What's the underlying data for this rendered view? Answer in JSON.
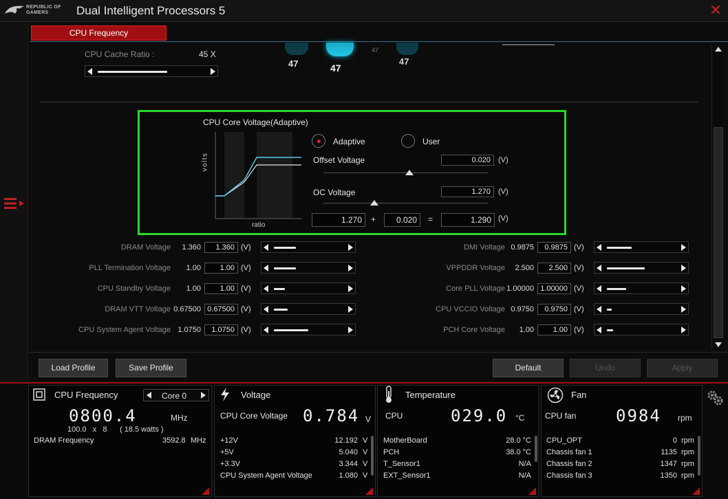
{
  "app": {
    "logo_text_line1": "REPUBLIC OF",
    "logo_text_line2": "GAMERS",
    "title": "Dual Intelligent Processors 5"
  },
  "tab": {
    "label": "CPU Frequency"
  },
  "cache_ratio": {
    "label": "CPU Cache Ratio :",
    "value": "45",
    "unit": "X",
    "slider_level": 0.65
  },
  "indicator_values": [
    "47",
    "47",
    "47",
    "47"
  ],
  "core_voltage": {
    "title": "CPU Core Voltage(Adaptive)",
    "y_axis": "volts",
    "x_axis": "ratio",
    "mode_adaptive": "Adaptive",
    "mode_user": "User",
    "selected_mode": "Adaptive",
    "offset_label": "Offset Voltage",
    "offset_value": "0.020",
    "oc_label": "OC Voltage",
    "oc_value": "1.270",
    "unit": "(V)",
    "sum_a": "1.270",
    "plus": "+",
    "sum_b": "0.020",
    "equals": "=",
    "sum_result": "1.290"
  },
  "left_voltages": [
    {
      "label": "DRAM Voltage",
      "current": "1.360",
      "input": "1.360",
      "unit": "(V)",
      "level": 0.32
    },
    {
      "label": "PLL Termination Voltage",
      "current": "1.00",
      "input": "1.00",
      "unit": "(V)",
      "level": 0.32
    },
    {
      "label": "CPU Standby Voltage",
      "current": "1.00",
      "input": "1.00",
      "unit": "(V)",
      "level": 0.16
    },
    {
      "label": "DRAM VTT Voltage",
      "current": "0.67500",
      "input": "0.67500",
      "unit": "(V)",
      "level": 0.2
    },
    {
      "label": "CPU System Agent Voltage",
      "current": "1.0750",
      "input": "1.0750",
      "unit": "(V)",
      "level": 0.5
    }
  ],
  "right_voltages": [
    {
      "label": "DMI Voltage",
      "current": "0.9875",
      "input": "0.9875",
      "unit": "(V)",
      "level": 0.36
    },
    {
      "label": "VPPDDR Voltage",
      "current": "2.500",
      "input": "2.500",
      "unit": "(V)",
      "level": 0.55
    },
    {
      "label": "Core PLL Voltage",
      "current": "1.00000",
      "input": "1.00000",
      "unit": "(V)",
      "level": 0.28
    },
    {
      "label": "CPU VCCIO Voltage",
      "current": "0.9750",
      "input": "0.9750",
      "unit": "(V)",
      "level": 0.07
    },
    {
      "label": "PCH Core Voltage",
      "current": "1.00",
      "input": "1.00",
      "unit": "(V)",
      "level": 0.09
    }
  ],
  "buttons": {
    "load_profile": "Load Profile",
    "save_profile": "Save Profile",
    "default": "Default",
    "undo": "Undo",
    "apply": "Apply"
  },
  "monitor_cpu": {
    "title": "CPU Frequency",
    "core_select": "Core 0",
    "freq": "0800.4",
    "freq_unit": "MHz",
    "ratio_line": "100.0   x   8",
    "watts": "( 18.5 watts )",
    "dram_label": "DRAM Frequency",
    "dram_value": "3592.8",
    "dram_unit": "MHz"
  },
  "monitor_voltage": {
    "title": "Voltage",
    "main_label": "CPU Core Voltage",
    "main_value": "0.784",
    "main_unit": "V",
    "rows": [
      {
        "label": "+12V",
        "value": "12.192",
        "unit": "V"
      },
      {
        "label": "+5V",
        "value": "5.040",
        "unit": "V"
      },
      {
        "label": "+3.3V",
        "value": "3.344",
        "unit": "V"
      },
      {
        "label": "CPU System Agent Voltage",
        "value": "1.080",
        "unit": "V"
      }
    ]
  },
  "monitor_temp": {
    "title": "Temperature",
    "main_label": "CPU",
    "main_value": "029.0",
    "main_unit": "°C",
    "rows": [
      {
        "label": "MotherBoard",
        "value": "28.0 °C"
      },
      {
        "label": "PCH",
        "value": "38.0 °C"
      },
      {
        "label": "T_Sensor1",
        "value": "N/A"
      },
      {
        "label": "EXT_Sensor1",
        "value": "N/A"
      }
    ]
  },
  "monitor_fan": {
    "title": "Fan",
    "main_label": "CPU fan",
    "main_value": "0984",
    "main_unit": "rpm",
    "rows": [
      {
        "label": "CPU_OPT",
        "value": "0",
        "unit": "rpm"
      },
      {
        "label": "Chassis fan 1",
        "value": "1135",
        "unit": "rpm"
      },
      {
        "label": "Chassis fan 2",
        "value": "1347",
        "unit": "rpm"
      },
      {
        "label": "Chassis fan 3",
        "value": "1350",
        "unit": "rpm"
      }
    ]
  },
  "colors": {
    "accent_red": "#a10e12",
    "highlight_green": "#29d829",
    "curve_blue": "#5bc8f0"
  }
}
